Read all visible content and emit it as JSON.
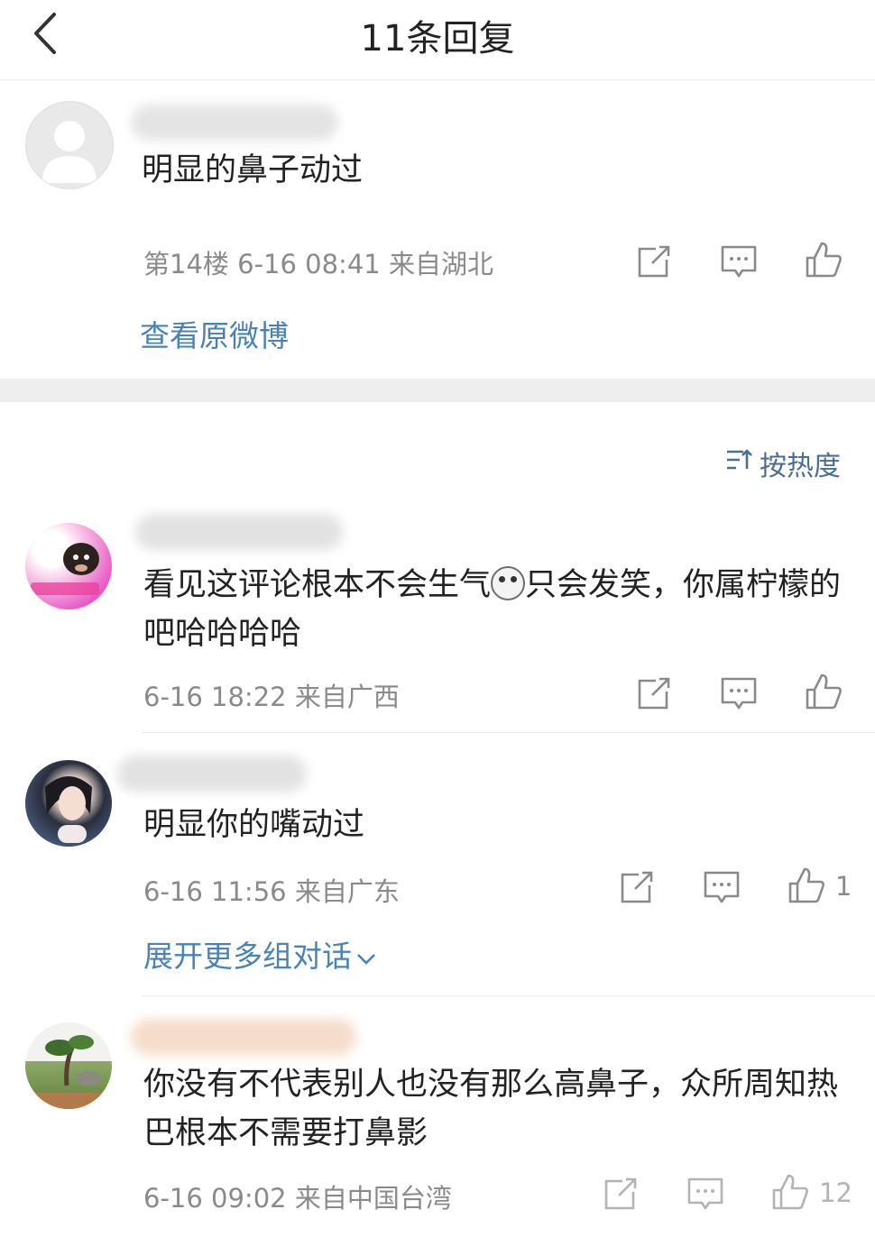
{
  "header": {
    "title": "11条回复",
    "back_icon": "back-arrow-icon"
  },
  "main_comment": {
    "text": "明显的鼻子动过",
    "meta": "第14楼 6-16 08:41 来自湖北",
    "view_original": "查看原微博"
  },
  "sort": {
    "label": "按热度",
    "icon": "sort-icon"
  },
  "replies": [
    {
      "text_before_emoji": "看见这评论根本不会生气",
      "text_after_emoji": "只会发笑，你属柠檬的吧哈哈哈哈",
      "meta": "6-16 18:22 来自广西",
      "likes": ""
    },
    {
      "text": "明显你的嘴动过",
      "meta": "6-16 11:56 来自广东",
      "likes": "1",
      "expand": "展开更多组对话"
    },
    {
      "text": "你没有不代表别人也没有那么高鼻子，众所周知热巴根本不需要打鼻影",
      "meta": "6-16 09:02 来自中国台湾",
      "likes": "12"
    }
  ],
  "colors": {
    "link": "#4a82b6",
    "meta": "#8a8a8a",
    "separator": "#eeeeee"
  }
}
